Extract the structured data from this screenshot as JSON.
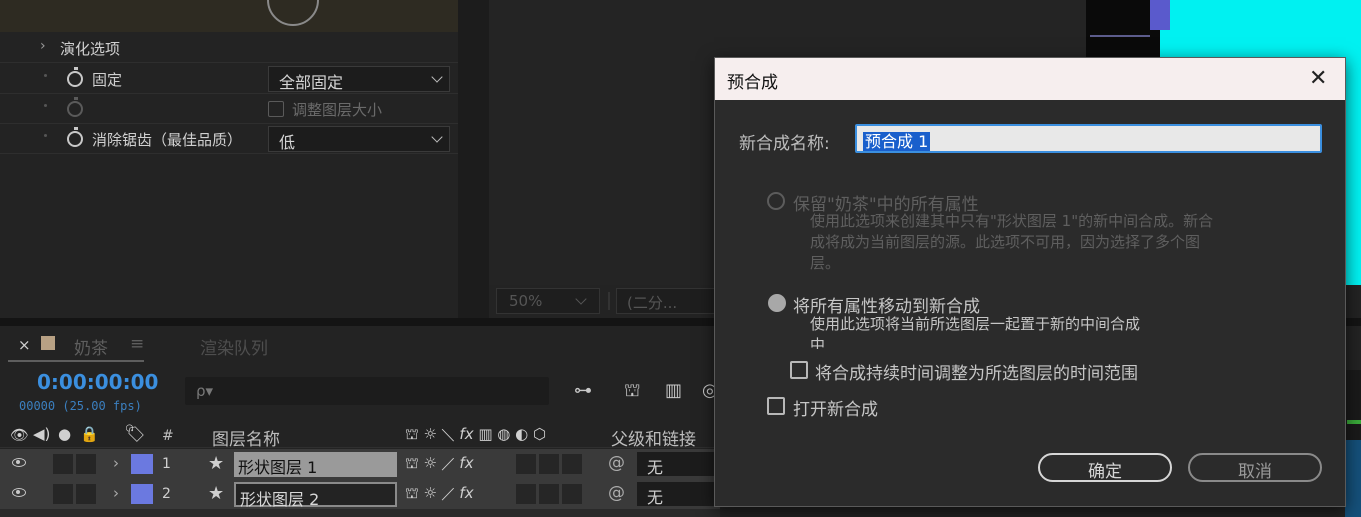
{
  "effect_controls": {
    "evolution_options": "演化选项",
    "fixed_label": "固定",
    "fixed_value": "全部固定",
    "resize_layer": "调整图层大小",
    "antialias_label": "消除锯齿（最佳品质）",
    "antialias_value": "低"
  },
  "viewer": {
    "zoom": "50%",
    "resolution": "(二分..."
  },
  "timeline": {
    "close": "×",
    "comp_name": "奶茶",
    "menu": "≡",
    "render_queue": "渲染队列",
    "timecode": "0:00:00:00",
    "fps": "00000 (25.00 fps)",
    "search_placeholder": "ρ▾",
    "columns": {
      "num": "#",
      "layer_name": "图层名称",
      "parent": "父级和链接"
    },
    "layers": [
      {
        "num": "1",
        "name": "形状图层 1",
        "parent": "无"
      },
      {
        "num": "2",
        "name": "形状图层 2",
        "parent": "无"
      }
    ],
    "comp_swatch_color": "#b8a184",
    "layer_label_color": "#6b79e0"
  },
  "dialog": {
    "title": "预合成",
    "close": "✕",
    "name_label": "新合成名称:",
    "name_value": "预合成 1",
    "option1_title": "保留\"奶茶\"中的所有属性",
    "option1_desc_1": "使用此选项来创建其中只有\"形状图层 1\"的新中间合成。新合",
    "option1_desc_2": "成将成为当前图层的源。此选项不可用，因为选择了多个图",
    "option1_desc_3": "层。",
    "option2_title": "将所有属性移动到新合成",
    "option2_desc_1": "使用此选项将当前所选图层一起置于新的中间合成",
    "option2_desc_2": "中",
    "adjust_duration": "将合成持续时间调整为所选图层的时间范围",
    "open_new": "打开新合成",
    "ok": "确定",
    "cancel": "取消"
  }
}
